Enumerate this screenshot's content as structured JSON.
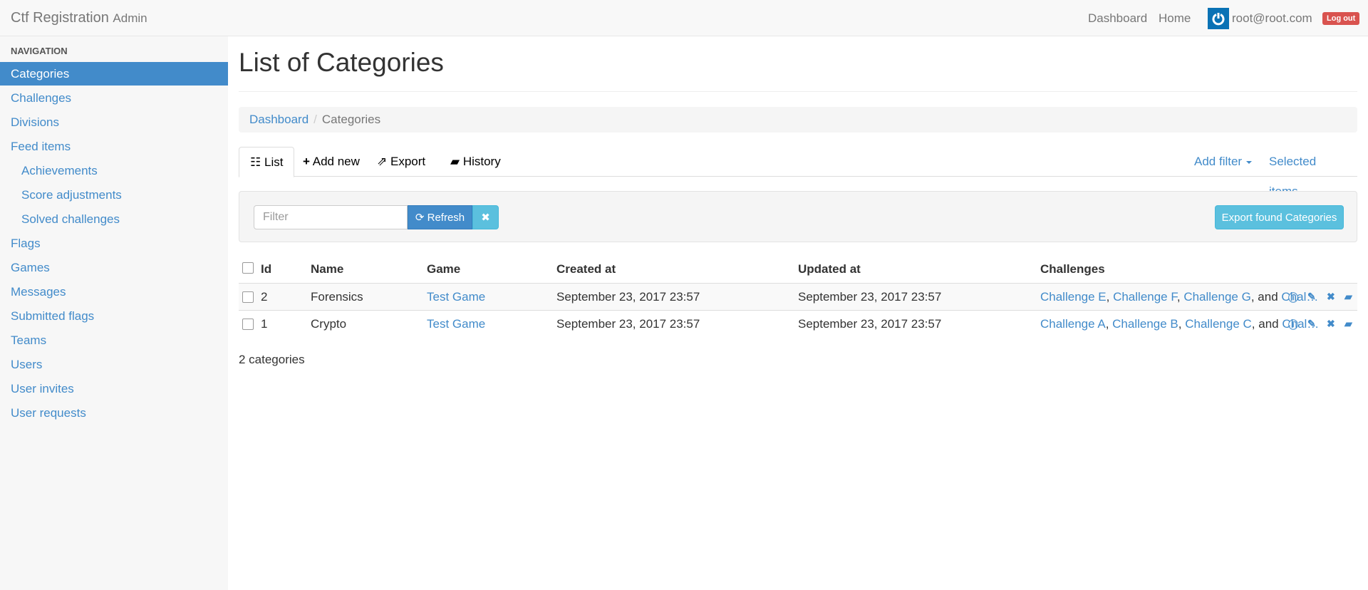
{
  "navbar": {
    "brand": "Ctf Registration",
    "brand_suffix": "Admin",
    "links": [
      "Dashboard",
      "Home"
    ],
    "user": "root@root.com",
    "logout": "Log out"
  },
  "sidebar": {
    "header": "NAVIGATION",
    "items": [
      {
        "label": "Categories"
      },
      {
        "label": "Challenges"
      },
      {
        "label": "Divisions"
      },
      {
        "label": "Feed items"
      },
      {
        "label": "Achievements"
      },
      {
        "label": "Score adjustments"
      },
      {
        "label": "Solved challenges"
      },
      {
        "label": "Flags"
      },
      {
        "label": "Games"
      },
      {
        "label": "Messages"
      },
      {
        "label": "Submitted flags"
      },
      {
        "label": "Teams"
      },
      {
        "label": "Users"
      },
      {
        "label": "User invites"
      },
      {
        "label": "User requests"
      }
    ]
  },
  "page": {
    "title": "List of Categories",
    "breadcrumb": [
      "Dashboard",
      "Categories"
    ]
  },
  "tabs": {
    "list": "List",
    "add": "Add new",
    "export": "Export",
    "history": "History",
    "add_filter": "Add filter",
    "selected": "Selected items"
  },
  "filter": {
    "placeholder": "Filter",
    "refresh": "Refresh",
    "clear": "✖",
    "export_found": "Export found Categories"
  },
  "table": {
    "headers": [
      "Id",
      "Name",
      "Game",
      "Created at",
      "Updated at",
      "Challenges"
    ],
    "rows": [
      {
        "id": "2",
        "name": "Forensics",
        "game": "Test Game",
        "created": "September 23, 2017 23:57",
        "updated": "September 23, 2017 23:57",
        "challenges": [
          "Challenge E",
          "Challenge F",
          "Challenge G"
        ],
        "and": "and",
        "more": "Chal…"
      },
      {
        "id": "1",
        "name": "Crypto",
        "game": "Test Game",
        "created": "September 23, 2017 23:57",
        "updated": "September 23, 2017 23:57",
        "challenges": [
          "Challenge A",
          "Challenge B",
          "Challenge C"
        ],
        "and": "and",
        "more": "Chal…"
      }
    ]
  },
  "count": "2 categories"
}
